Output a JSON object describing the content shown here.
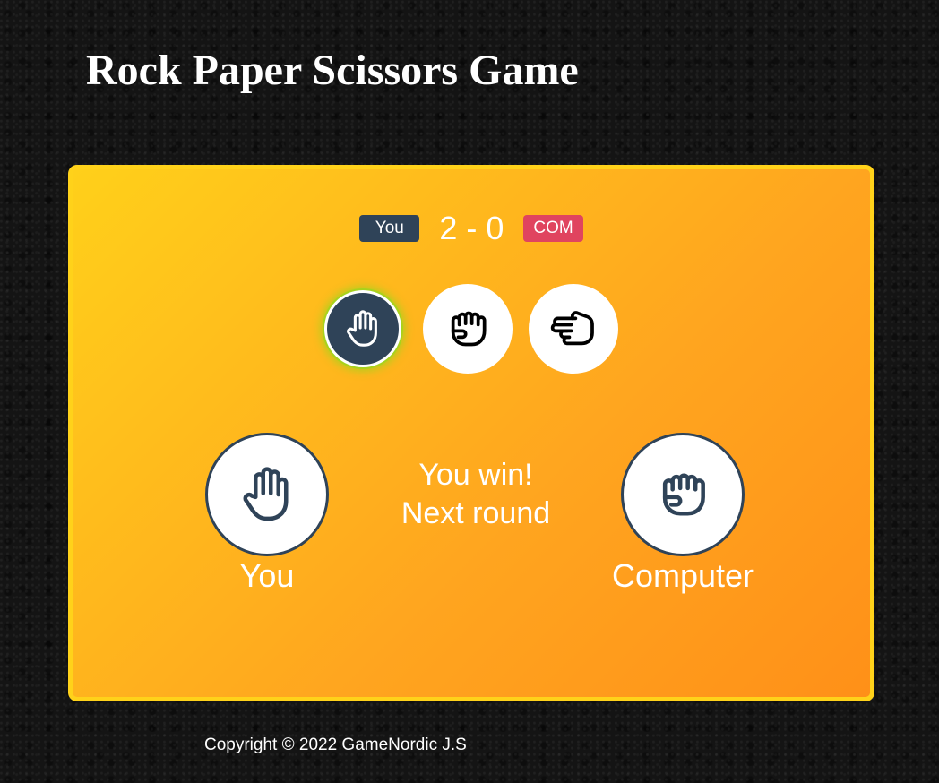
{
  "page": {
    "title": "Rock Paper Scissors Game"
  },
  "scoreboard": {
    "user_label": "You",
    "score": "2 - 0",
    "computer_label": "COM",
    "user_score": 2,
    "computer_score": 0
  },
  "choices": [
    {
      "name": "paper",
      "icon": "open-hand-icon",
      "selected": true
    },
    {
      "name": "rock",
      "icon": "fist-icon",
      "selected": false
    },
    {
      "name": "scissors",
      "icon": "scissors-hand-icon",
      "selected": false
    }
  ],
  "result": {
    "player_label": "You",
    "player_choice_icon": "open-hand-icon",
    "computer_label": "Computer",
    "computer_choice_icon": "fist-icon",
    "message_line1": "You win!",
    "message_line2": "Next round"
  },
  "footer": {
    "copyright": "Copyright © 2022 GameNordic J.S"
  },
  "colors": {
    "board_gradient_start": "#ffd01a",
    "board_gradient_end": "#ff9018",
    "board_border": "#ffd21a",
    "dark_slate": "#2f4358",
    "com_badge": "#e0445f",
    "selected_glow": "#a8d21c"
  }
}
